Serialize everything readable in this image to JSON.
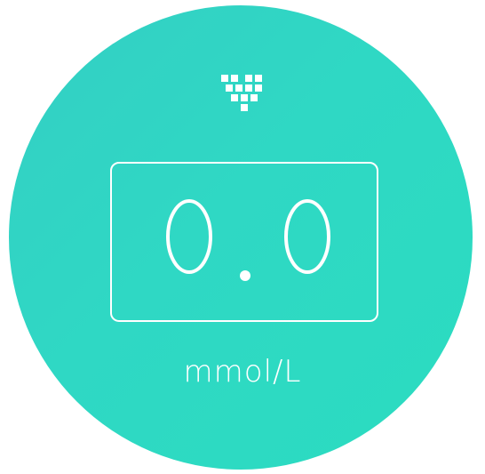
{
  "meter": {
    "logo_icon": "dot-matrix-heart-icon",
    "reading": "0.0",
    "unit": "mmol/L"
  },
  "colors": {
    "dial_gradient_start": "#34cfc4",
    "dial_gradient_end": "#2bdcc0",
    "foreground": "#ffffff",
    "background": "#ffffff"
  }
}
